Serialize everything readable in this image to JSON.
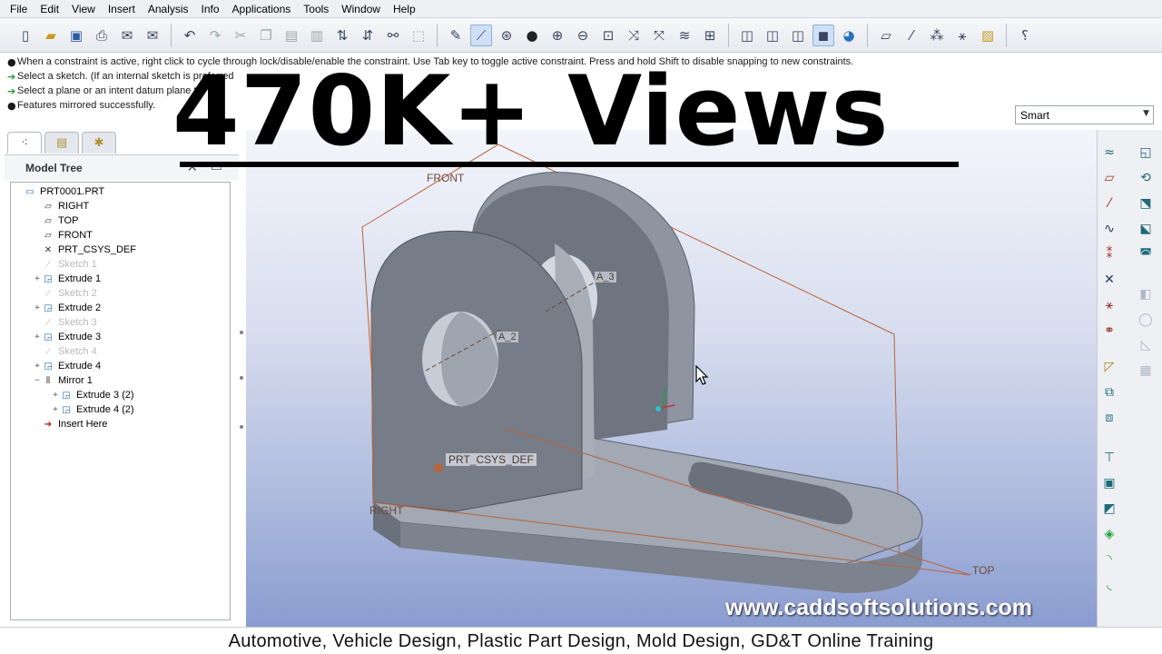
{
  "menu": [
    "File",
    "Edit",
    "View",
    "Insert",
    "Analysis",
    "Info",
    "Applications",
    "Tools",
    "Window",
    "Help"
  ],
  "messages": [
    {
      "type": "dot",
      "text": "When a constraint is active, right click to cycle through lock/disable/enable the constraint. Use Tab key to toggle active constraint. Press and hold Shift to disable snapping to new constraints."
    },
    {
      "type": "arrow",
      "text": "Select a sketch. (If an internal sketch is preferred"
    },
    {
      "type": "arrow",
      "text": "Select a plane or an intent datum plane to"
    },
    {
      "type": "dot",
      "text": "Features mirrored successfully."
    }
  ],
  "filter": {
    "value": "Smart"
  },
  "model_tree": {
    "title": "Model Tree",
    "items": [
      {
        "label": "PRT0001.PRT",
        "icon": "part-icon",
        "indent": 0,
        "exp": "",
        "dim": false
      },
      {
        "label": "RIGHT",
        "icon": "datum-plane-icon",
        "indent": 1,
        "exp": "",
        "dim": false
      },
      {
        "label": "TOP",
        "icon": "datum-plane-icon",
        "indent": 1,
        "exp": "",
        "dim": false
      },
      {
        "label": "FRONT",
        "icon": "datum-plane-icon",
        "indent": 1,
        "exp": "",
        "dim": false
      },
      {
        "label": "PRT_CSYS_DEF",
        "icon": "csys-icon",
        "indent": 1,
        "exp": "",
        "dim": false
      },
      {
        "label": "Sketch 1",
        "icon": "sketch-icon",
        "indent": 1,
        "exp": "",
        "dim": true
      },
      {
        "label": "Extrude 1",
        "icon": "extrude-icon",
        "indent": 1,
        "exp": "+",
        "dim": false
      },
      {
        "label": "Sketch 2",
        "icon": "sketch-icon",
        "indent": 1,
        "exp": "",
        "dim": true
      },
      {
        "label": "Extrude 2",
        "icon": "extrude-icon",
        "indent": 1,
        "exp": "+",
        "dim": false
      },
      {
        "label": "Sketch 3",
        "icon": "sketch-icon",
        "indent": 1,
        "exp": "",
        "dim": true
      },
      {
        "label": "Extrude 3",
        "icon": "extrude-icon",
        "indent": 1,
        "exp": "+",
        "dim": false
      },
      {
        "label": "Sketch 4",
        "icon": "sketch-icon",
        "indent": 1,
        "exp": "",
        "dim": true
      },
      {
        "label": "Extrude 4",
        "icon": "extrude-icon",
        "indent": 1,
        "exp": "+",
        "dim": false
      },
      {
        "label": "Mirror 1",
        "icon": "mirror-icon",
        "indent": 1,
        "exp": "−",
        "dim": false
      },
      {
        "label": "Extrude 3 (2)",
        "icon": "extrude-icon",
        "indent": 2,
        "exp": "+",
        "dim": false
      },
      {
        "label": "Extrude 4 (2)",
        "icon": "extrude-icon",
        "indent": 2,
        "exp": "+",
        "dim": false
      },
      {
        "label": "Insert Here",
        "icon": "insert-here-icon",
        "indent": 1,
        "exp": "",
        "dim": false
      }
    ]
  },
  "viewport": {
    "labels": {
      "front": "FRONT",
      "top": "TOP",
      "right": "RIGHT",
      "csys": "PRT_CSYS_DEF",
      "axis_a2": "A_2",
      "axis_a3": "A_3"
    }
  },
  "overlay": {
    "headline": "470K+ Views",
    "website": "www.caddsoftsolutions.com",
    "footer": "Automotive, Vehicle Design, Plastic Part Design, Mold Design, GD&T Online Training"
  },
  "colors": {
    "datum": "#b8643c",
    "part_face": "#8e94a0",
    "accent": "#1f9a2e"
  }
}
